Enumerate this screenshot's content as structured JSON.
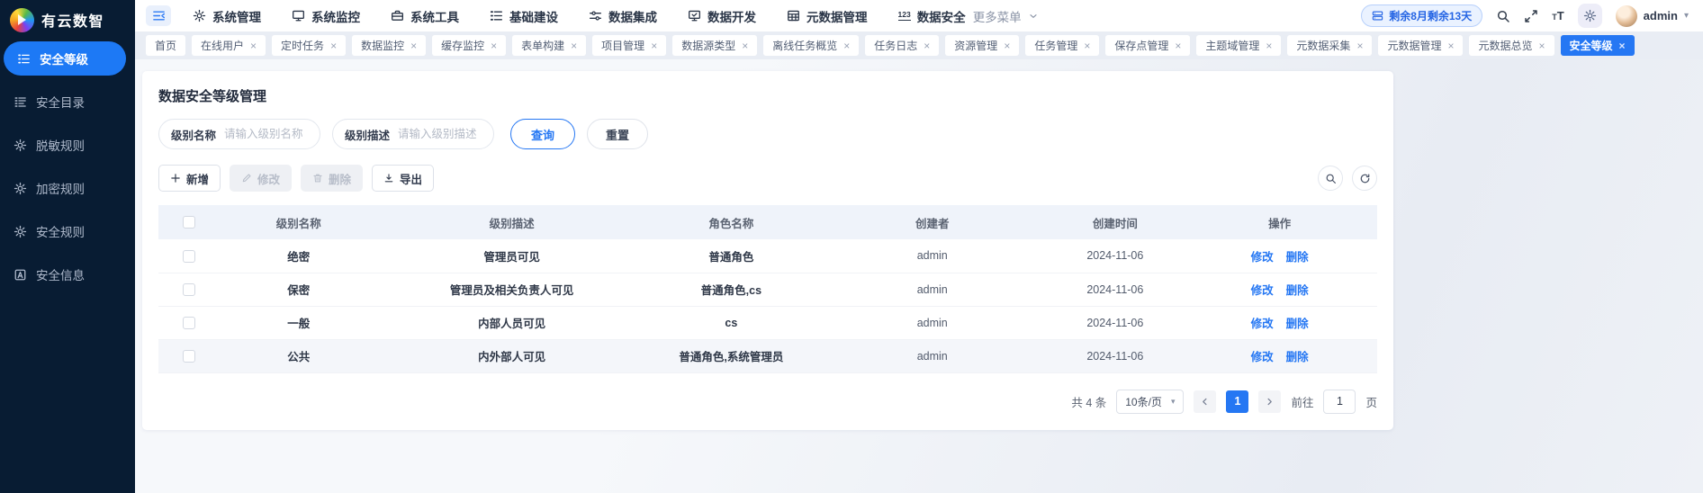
{
  "brand": {
    "name": "有云数智"
  },
  "topnav": {
    "items": [
      {
        "label": "系统管理",
        "icon": "gear"
      },
      {
        "label": "系统监控",
        "icon": "monitor"
      },
      {
        "label": "系统工具",
        "icon": "toolbox"
      },
      {
        "label": "基础建设",
        "icon": "list-build"
      },
      {
        "label": "数据集成",
        "icon": "sliders"
      },
      {
        "label": "数据开发",
        "icon": "monitor-check"
      },
      {
        "label": "元数据管理",
        "icon": "grid-table"
      },
      {
        "label": "数据安全",
        "icon": "one-two-three"
      }
    ],
    "more_label": "更多菜单"
  },
  "topbar_right": {
    "license_badge": "剩余8月剩余13天",
    "username": "admin"
  },
  "sidebar": {
    "items": [
      {
        "label": "安全等级",
        "icon": "list-level",
        "active": true
      },
      {
        "label": "安全目录",
        "icon": "list-catalog",
        "active": false
      },
      {
        "label": "脱敏规则",
        "icon": "gear",
        "active": false
      },
      {
        "label": "加密规则",
        "icon": "gear",
        "active": false
      },
      {
        "label": "安全规则",
        "icon": "gear",
        "active": false
      },
      {
        "label": "安全信息",
        "icon": "box-a",
        "active": false
      }
    ]
  },
  "tabs": [
    {
      "label": "首页",
      "closable": false,
      "active": false
    },
    {
      "label": "在线用户",
      "closable": true,
      "active": false
    },
    {
      "label": "定时任务",
      "closable": true,
      "active": false
    },
    {
      "label": "数据监控",
      "closable": true,
      "active": false
    },
    {
      "label": "缓存监控",
      "closable": true,
      "active": false
    },
    {
      "label": "表单构建",
      "closable": true,
      "active": false
    },
    {
      "label": "项目管理",
      "closable": true,
      "active": false
    },
    {
      "label": "数据源类型",
      "closable": true,
      "active": false
    },
    {
      "label": "离线任务概览",
      "closable": true,
      "active": false
    },
    {
      "label": "任务日志",
      "closable": true,
      "active": false
    },
    {
      "label": "资源管理",
      "closable": true,
      "active": false
    },
    {
      "label": "任务管理",
      "closable": true,
      "active": false
    },
    {
      "label": "保存点管理",
      "closable": true,
      "active": false
    },
    {
      "label": "主题域管理",
      "closable": true,
      "active": false
    },
    {
      "label": "元数据采集",
      "closable": true,
      "active": false
    },
    {
      "label": "元数据管理",
      "closable": true,
      "active": false
    },
    {
      "label": "元数据总览",
      "closable": true,
      "active": false
    },
    {
      "label": "安全等级",
      "closable": true,
      "active": true
    }
  ],
  "page": {
    "title": "数据安全等级管理",
    "filters": {
      "name_label": "级别名称",
      "name_placeholder": "请输入级别名称",
      "desc_label": "级别描述",
      "desc_placeholder": "请输入级别描述",
      "search_label": "查询",
      "reset_label": "重置"
    },
    "toolbar": {
      "add_label": "新增",
      "edit_label": "修改",
      "delete_label": "删除",
      "export_label": "导出"
    },
    "table": {
      "columns": [
        "级别名称",
        "级别描述",
        "角色名称",
        "创建者",
        "创建时间",
        "操作"
      ],
      "rows": [
        {
          "name": "绝密",
          "desc": "管理员可见",
          "roles": "普通角色",
          "creator": "admin",
          "created": "2024-11-06"
        },
        {
          "name": "保密",
          "desc": "管理员及相关负责人可见",
          "roles": "普通角色,cs",
          "creator": "admin",
          "created": "2024-11-06"
        },
        {
          "name": "一般",
          "desc": "内部人员可见",
          "roles": "cs",
          "creator": "admin",
          "created": "2024-11-06"
        },
        {
          "name": "公共",
          "desc": "内外部人可见",
          "roles": "普通角色,系统管理员",
          "creator": "admin",
          "created": "2024-11-06"
        }
      ],
      "row_actions": [
        "修改",
        "删除"
      ]
    },
    "pagination": {
      "total_text": "共 4 条",
      "page_size": "10条/页",
      "current_page": "1",
      "goto_label": "前往",
      "goto_value": "1",
      "page_suffix": "页"
    }
  },
  "colors": {
    "accent": "#2577f3",
    "sidebar_bg": "#081c33",
    "active_pill": "#1d79f5"
  }
}
